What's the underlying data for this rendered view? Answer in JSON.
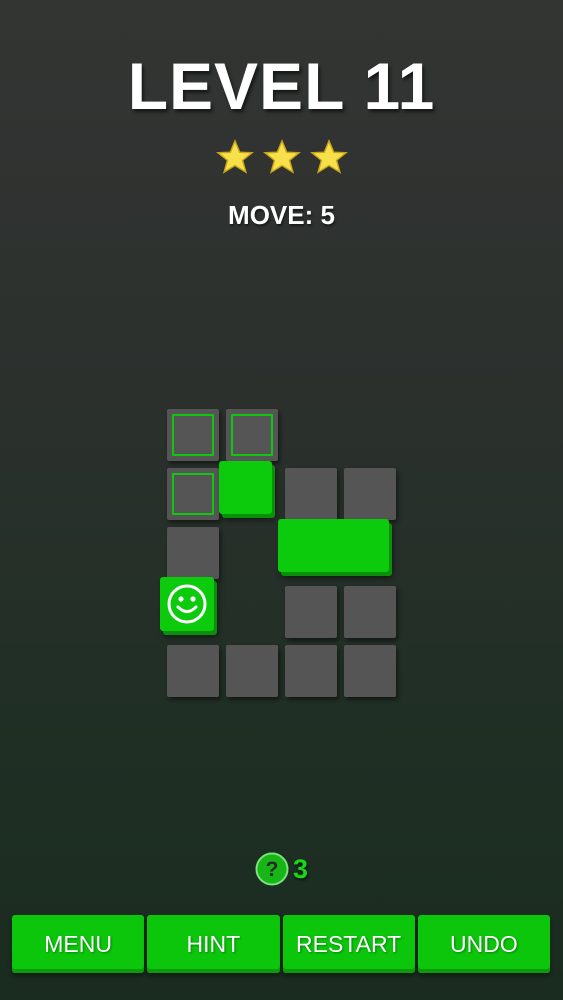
{
  "header": {
    "level_label": "LEVEL 11",
    "stars_earned": 3,
    "stars_total": 3,
    "moves_label": "MOVE: 5"
  },
  "icons": {
    "star": "star-icon",
    "player": "smiley-face-icon",
    "hint": "question-mark-icon"
  },
  "colors": {
    "block_green": "#0ccb0c",
    "tile_gray": "#555555",
    "target_outline": "#11c611",
    "star_yellow": "#f7e04a"
  },
  "hints": {
    "count": "3"
  },
  "toolbar": {
    "menu_label": "MENU",
    "hint_label": "HINT",
    "restart_label": "RESTART",
    "undo_label": "UNDO"
  }
}
